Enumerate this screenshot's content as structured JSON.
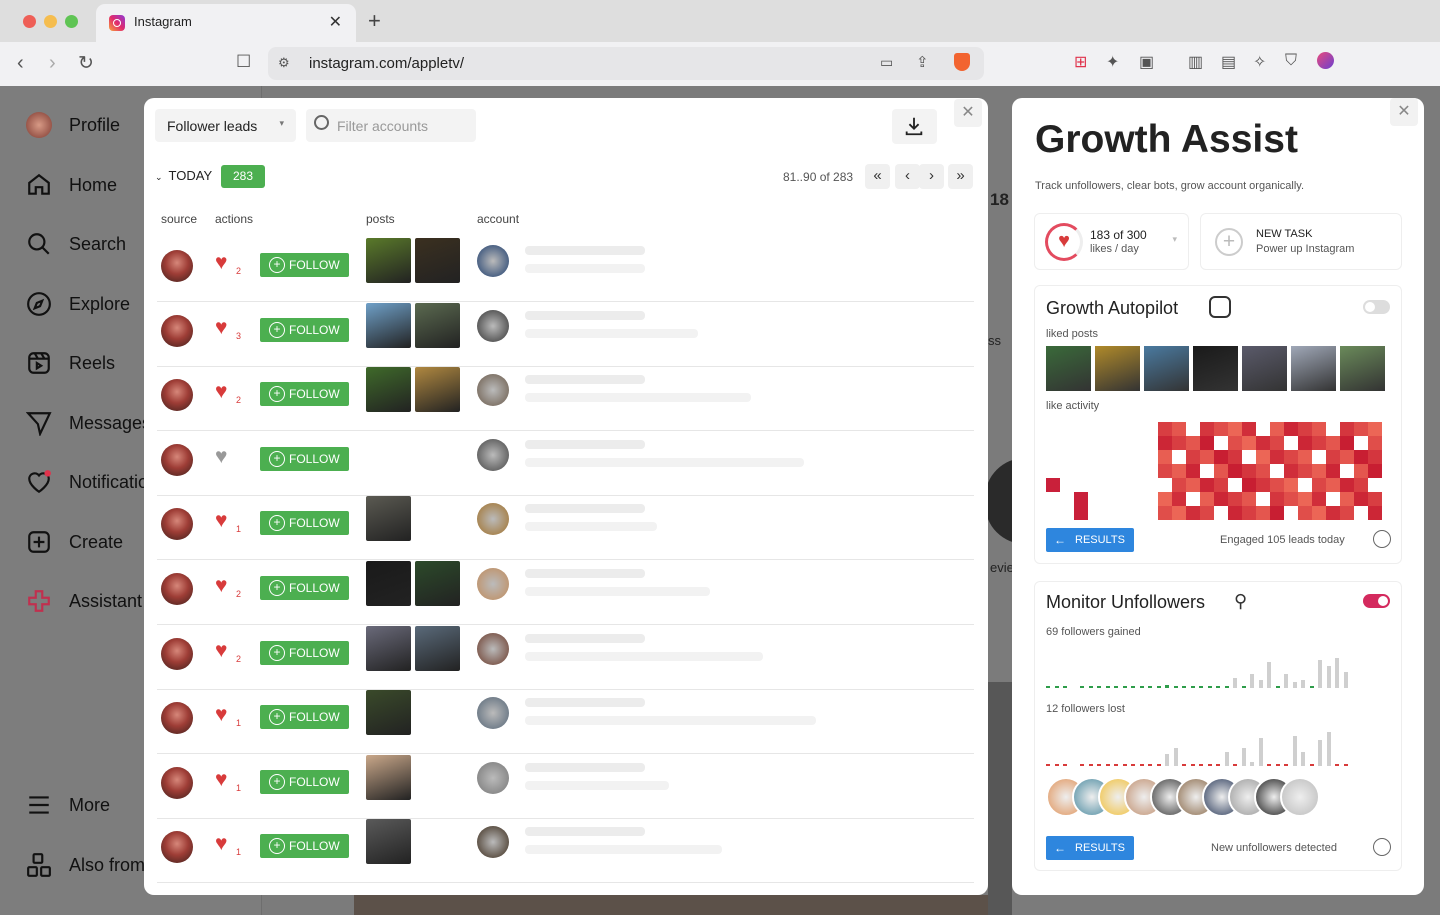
{
  "browser": {
    "tab_title": "Instagram",
    "url": "instagram.com/appletv/"
  },
  "sidebar": {
    "items": [
      {
        "label": "Profile",
        "icon": "profile-avatar"
      },
      {
        "label": "Home",
        "icon": "home-icon"
      },
      {
        "label": "Search",
        "icon": "search-icon"
      },
      {
        "label": "Explore",
        "icon": "compass-icon"
      },
      {
        "label": "Reels",
        "icon": "reels-icon"
      },
      {
        "label": "Messages",
        "icon": "messages-icon"
      },
      {
        "label": "Notificatio",
        "icon": "heart-icon"
      },
      {
        "label": "Create",
        "icon": "plus-square-icon"
      },
      {
        "label": "Assistant",
        "icon": "assistant-icon"
      },
      {
        "label": "More",
        "icon": "menu-icon"
      },
      {
        "label": "Also from",
        "icon": "grid-icon"
      }
    ]
  },
  "background": {
    "count_fragment": "18",
    "fragment_ss": "ss",
    "fragment_revie": "evie"
  },
  "leads_modal": {
    "dropdown": "Follower leads",
    "filter_placeholder": "Filter accounts",
    "group_label": "TODAY",
    "group_count": "283",
    "pager": "81..90 of 283",
    "columns": [
      "source",
      "actions",
      "posts",
      "account"
    ],
    "follow_label": "FOLLOW",
    "rows": [
      {
        "likes": "2",
        "posts": 2
      },
      {
        "likes": "3",
        "posts": 2
      },
      {
        "likes": "2",
        "posts": 2
      },
      {
        "likes": "",
        "posts": 0,
        "broken": true
      },
      {
        "likes": "1",
        "posts": 1
      },
      {
        "likes": "2",
        "posts": 2
      },
      {
        "likes": "2",
        "posts": 2
      },
      {
        "likes": "1",
        "posts": 1
      },
      {
        "likes": "1",
        "posts": 1
      },
      {
        "likes": "1",
        "posts": 1
      }
    ]
  },
  "growth_panel": {
    "title": "Growth Assist",
    "subtitle": "Track unfollowers, clear bots, grow account organically.",
    "likes_stat": "183 of 300",
    "likes_unit": "likes / day",
    "new_task_title": "NEW TASK",
    "new_task_sub": "Power up Instagram",
    "autopilot": {
      "title": "Growth Autopilot",
      "enabled": false,
      "liked_posts_label": "liked posts",
      "activity_label": "like activity",
      "results_label": "RESULTS",
      "status": "Engaged 105 leads today"
    },
    "unfollowers": {
      "title": "Monitor Unfollowers",
      "enabled": true,
      "gained_label": "69 followers gained",
      "lost_label": "12 followers lost",
      "results_label": "RESULTS",
      "status": "New unfollowers detected"
    }
  }
}
